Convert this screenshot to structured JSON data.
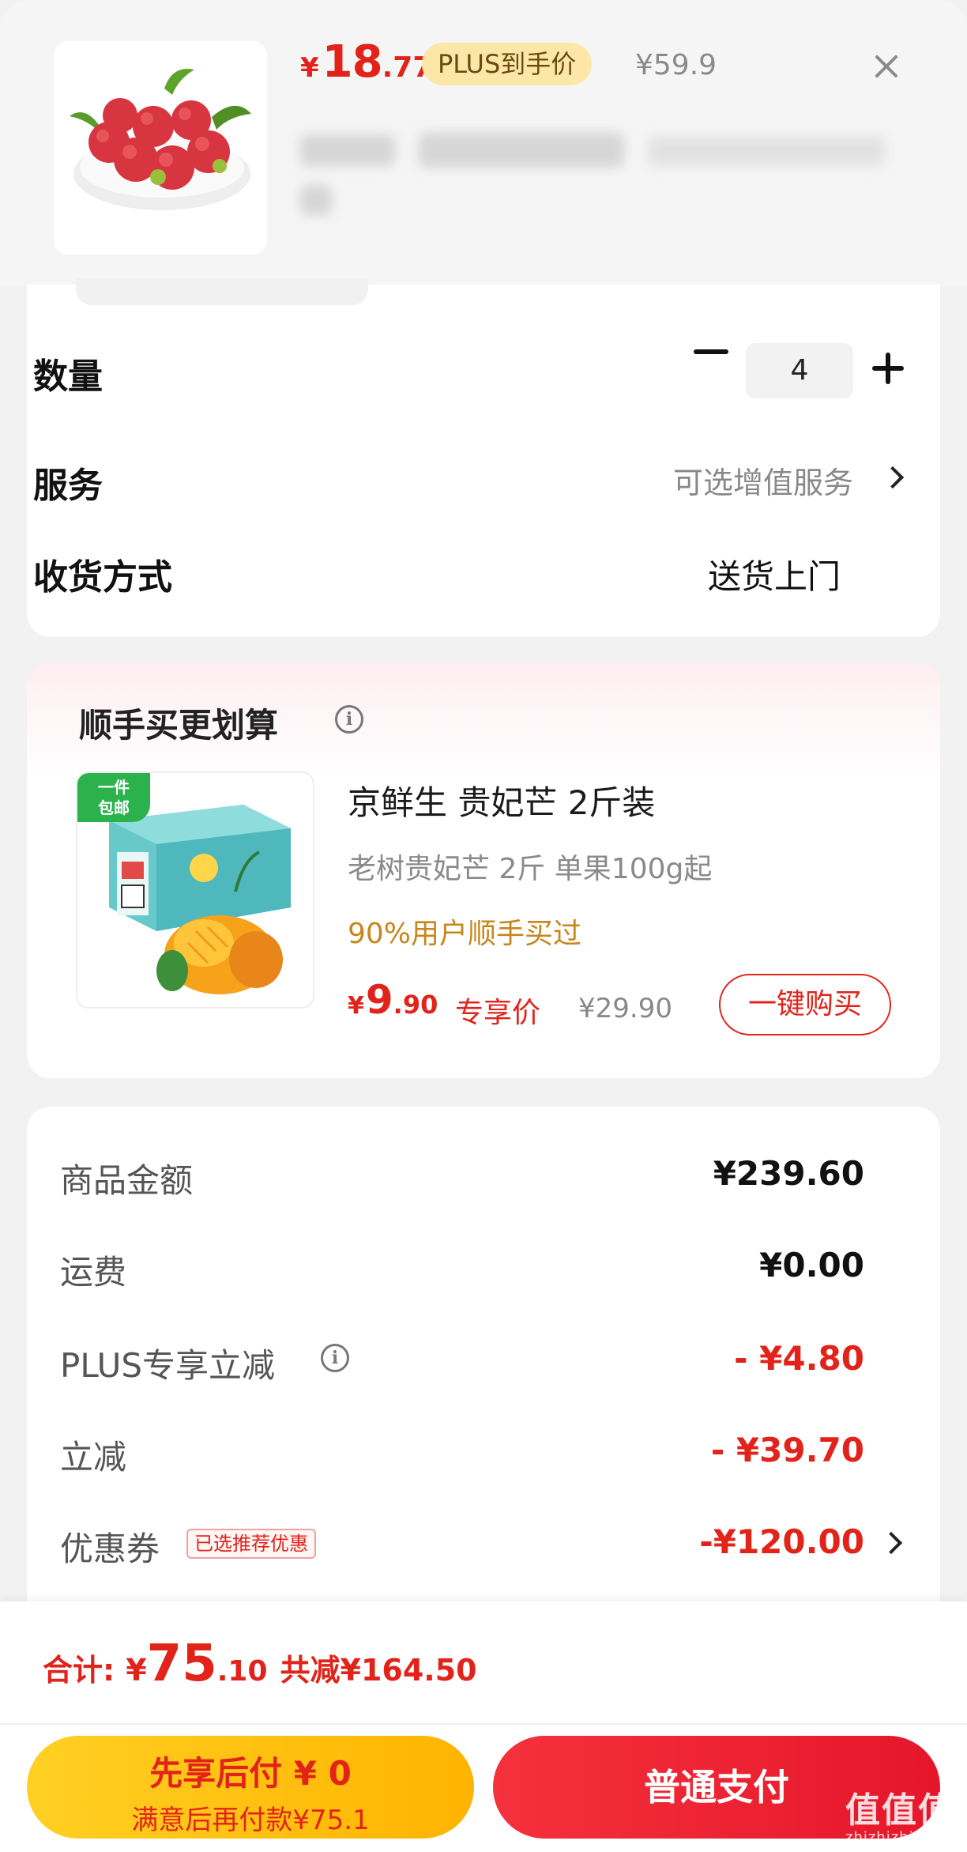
{
  "product": {
    "image_icon": "lychee-image",
    "price_symbol": "¥",
    "price_int": "18",
    "price_dec": ".77",
    "plus_badge": "PLUS到手价",
    "original_price": "¥59.9"
  },
  "options": {
    "quantity_label": "数量",
    "quantity_value": "4",
    "service_label": "服务",
    "service_value": "可选增值服务",
    "delivery_label": "收货方式",
    "delivery_value": "送货上门"
  },
  "recommend": {
    "title": "顺手买更划算",
    "badge_line1": "一件",
    "badge_line2": "包邮",
    "image_icon": "mango-box-image",
    "name": "京鲜生 贵妃芒 2斤装",
    "desc": "老树贵妃芒  2斤 单果100g起",
    "social": "90%用户顺手买过",
    "price_symbol": "¥",
    "price_int": "9",
    "price_dec": ".90",
    "price_tag": "专享价",
    "original_price": "¥29.90",
    "buy_label": "一键购买"
  },
  "amounts": [
    {
      "label": "商品金额",
      "value": "¥239.60"
    },
    {
      "label": "运费",
      "value": "¥0.00"
    },
    {
      "label": "PLUS专享立减",
      "value": "- ¥4.80"
    },
    {
      "label": "立减",
      "value": "- ¥39.70"
    },
    {
      "label": "优惠券",
      "value": "-¥120.00",
      "tag": "已选推荐优惠"
    }
  ],
  "footer": {
    "total_label": "合计:",
    "total_symbol": "¥",
    "total_int": "75",
    "total_dec": ".10",
    "saved": "共减¥164.50",
    "pay_later_line1": "先享后付 ¥ 0",
    "pay_later_line2": "满意后再付款¥75.1",
    "pay_now": "普通支付"
  },
  "watermark": {
    "logo": "值值值",
    "site": "zhizhizhi.com"
  },
  "colors": {
    "accent_red": "#e2231a",
    "plus_gold": "#fde7a8",
    "social_orange": "#c7861c",
    "pay_later_yellow": "#ffc107"
  }
}
